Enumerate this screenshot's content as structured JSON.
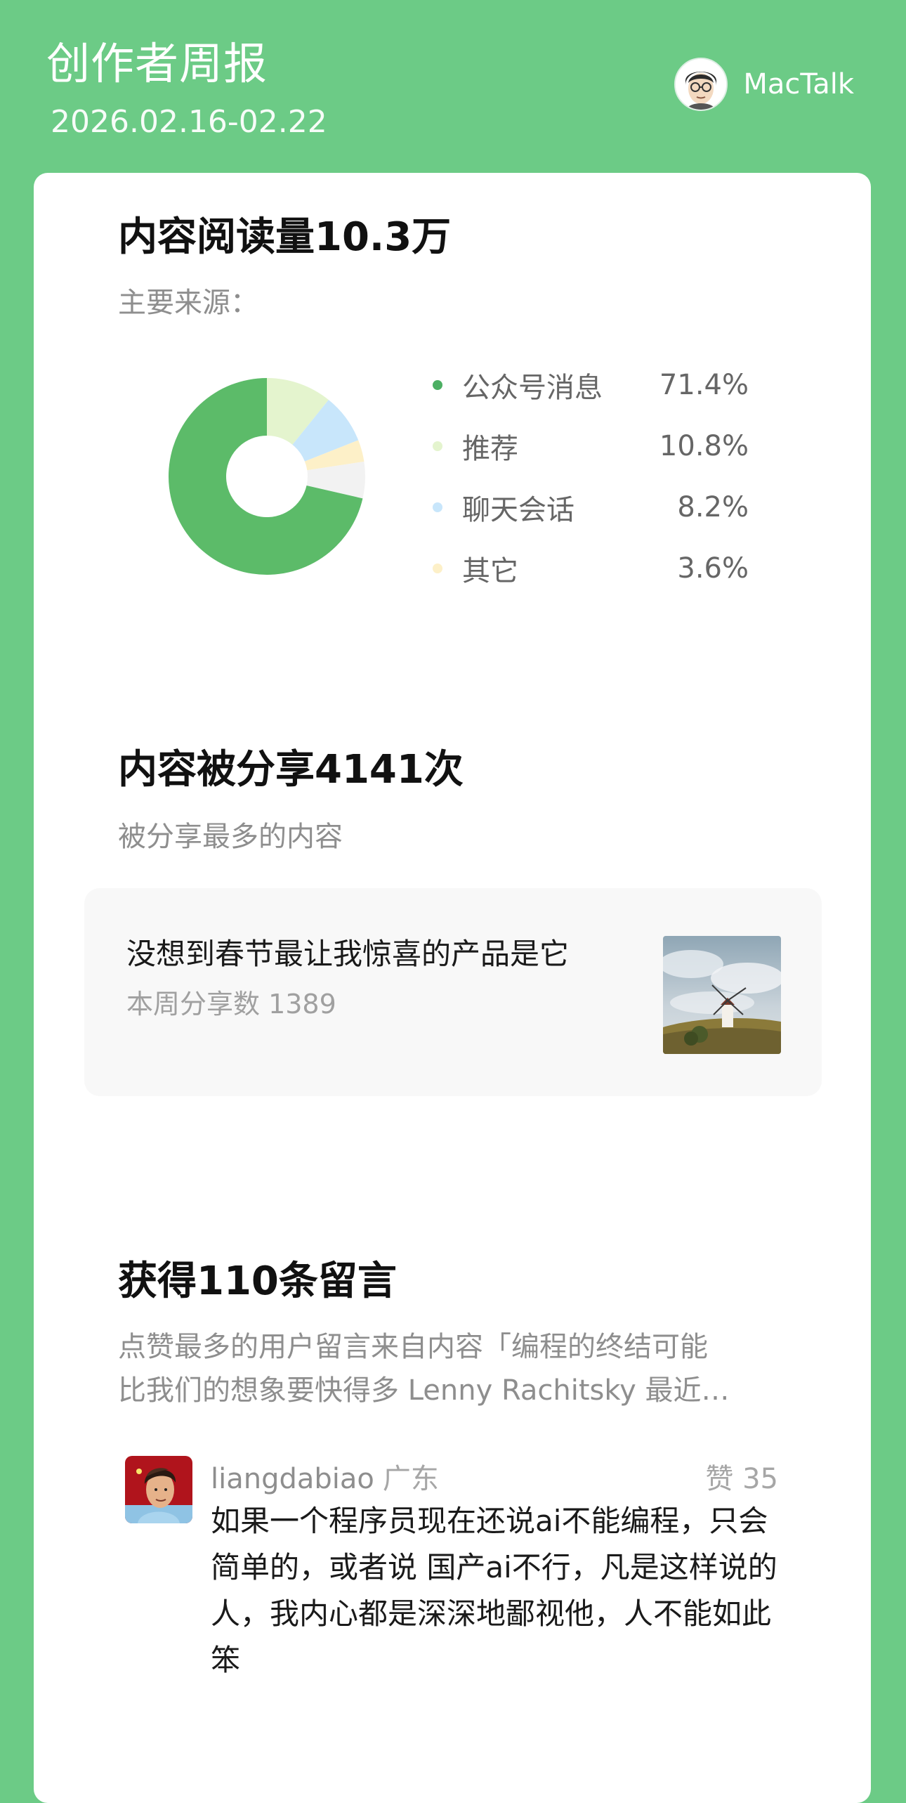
{
  "header": {
    "title": "创作者周报",
    "date_range": "2026.02.16-02.22",
    "account_name": "MacTalk",
    "avatar_icon": "cartoon-face-avatar"
  },
  "reads": {
    "title": "内容阅读量10.3万",
    "subtitle": "主要来源："
  },
  "chart_data": {
    "type": "pie",
    "donut": true,
    "categories": [
      "公众号消息",
      "推荐",
      "聊天会话",
      "其它"
    ],
    "values": [
      71.4,
      10.8,
      8.2,
      3.6
    ],
    "labels": [
      "71.4%",
      "10.8%",
      "8.2%",
      "3.6%"
    ],
    "colors": [
      "#5CBB69",
      "#E4F4CE",
      "#C8E6FB",
      "#FDF0C8"
    ],
    "remainder_color": "#F2F2F2",
    "legend": "right"
  },
  "shares": {
    "title": "内容被分享4141次",
    "subtitle": "被分享最多的内容",
    "top_title": "没想到春节最让我惊喜的产品是它",
    "top_count": "本周分享数 1389",
    "thumb_icon": "windmill-photo"
  },
  "comments": {
    "title": "获得110条留言",
    "desc_line1": "点赞最多的用户留言来自内容「编程的终结可能",
    "desc_line2": "比我们的想象要快得多 Lenny Rachitsky 最近…",
    "user": "liangdabiao",
    "region": "广东",
    "likes": "赞 35",
    "text": "如果一个程序员现在还说ai不能编程，只会简单的，或者说 国产ai不行，凡是这样说的人，我内心都是深深地鄙视他，人不能如此笨"
  }
}
